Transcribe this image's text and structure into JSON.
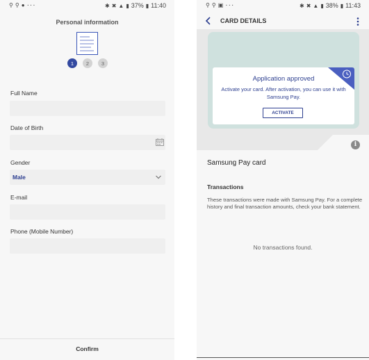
{
  "left_screen": {
    "status": {
      "battery": "37%",
      "time": "11:40"
    },
    "title": "Personal information",
    "steps": [
      "1",
      "2",
      "3"
    ],
    "fields": {
      "full_name_label": "Full Name",
      "dob_label": "Date of Birth",
      "gender_label": "Gender",
      "gender_value": "Male",
      "email_label": "E-mail",
      "phone_label": "Phone (Mobile Number)"
    },
    "confirm_label": "Confirm"
  },
  "right_screen": {
    "status": {
      "battery": "38%",
      "time": "11:43"
    },
    "header_title": "CARD DETAILS",
    "notice": {
      "title": "Application approved",
      "text": "Activate your card. After activation, you can use it with Samsung Pay.",
      "button": "ACTIVATE"
    },
    "info_glyph": "i",
    "card_name": "Samsung Pay card",
    "transactions_title": "Transactions",
    "transactions_desc": "These transactions were made with Samsung Pay. For a complete history and final transaction amounts, check your  bank statement.",
    "no_transactions": "No transactions found."
  },
  "colors": {
    "accent": "#2c3e8f",
    "step_active": "#3349a0",
    "card_bg": "#cfe1de",
    "corner_badge": "#4a5fc0"
  },
  "icons": {
    "status_left": [
      "signal-icon",
      "nfc-icon",
      "messenger-icon",
      "more-dots-icon"
    ],
    "status_right": [
      "bluetooth-icon",
      "mute-icon",
      "wifi-icon",
      "cellular-icon",
      "battery-icon"
    ],
    "header": [
      "back-arrow-icon",
      "more-vertical-icon"
    ],
    "fields": [
      "calendar-icon",
      "chevron-down-icon"
    ],
    "notice": [
      "clock-icon"
    ],
    "card": [
      "info-icon"
    ]
  }
}
